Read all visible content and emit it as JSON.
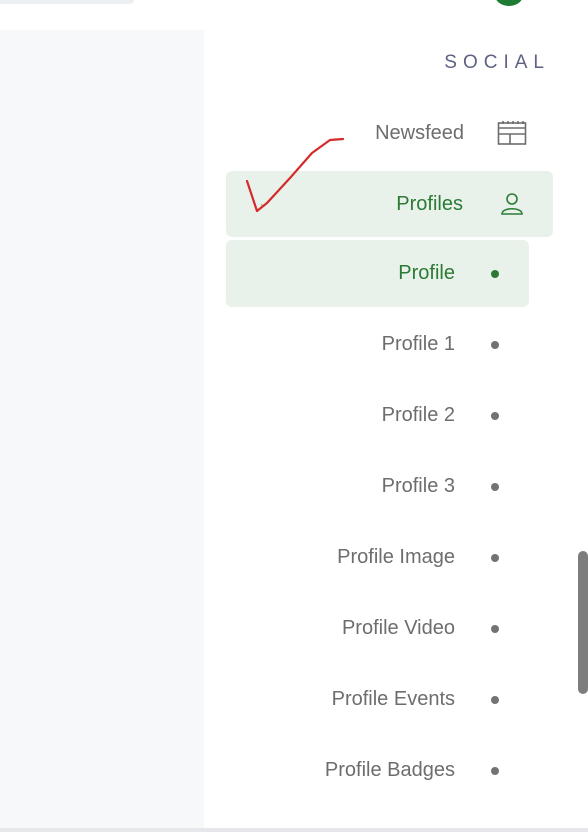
{
  "sidebar": {
    "section_title": "SOCIAL",
    "newsfeed": {
      "label": "Newsfeed",
      "icon": "newsfeed-icon"
    },
    "profiles": {
      "label": "Profiles",
      "icon": "user-icon",
      "expanded": true
    },
    "submenu": [
      {
        "label": "Profile",
        "active": true
      },
      {
        "label": "Profile 1",
        "active": false
      },
      {
        "label": "Profile 2",
        "active": false
      },
      {
        "label": "Profile 3",
        "active": false
      },
      {
        "label": "Profile Image",
        "active": false
      },
      {
        "label": "Profile Video",
        "active": false
      },
      {
        "label": "Profile Events",
        "active": false
      },
      {
        "label": "Profile Badges",
        "active": false
      }
    ]
  },
  "colors": {
    "accent": "#2c7a35",
    "active_bg": "#e9f2ea",
    "section_title": "#5e6284",
    "annotation_mark": "#d42a2a"
  }
}
